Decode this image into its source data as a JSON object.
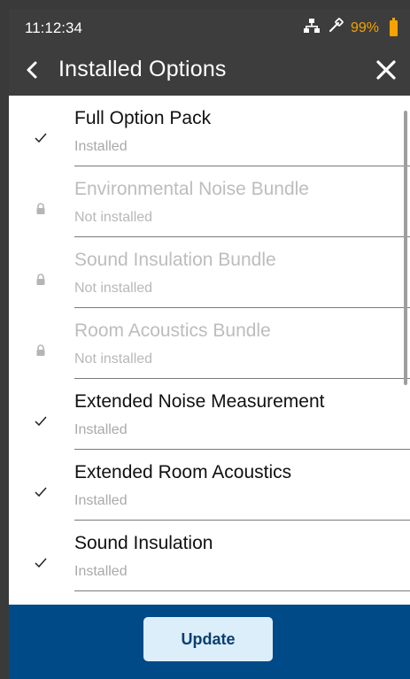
{
  "status": {
    "time": "11:12:34",
    "network_icon": "network-icon",
    "probe_icon": "probe-icon",
    "battery_percent": "99%",
    "accent": "#f5a300"
  },
  "header": {
    "title": "Installed Options",
    "back_icon": "chevron-left-icon",
    "close_icon": "close-icon"
  },
  "items": [
    {
      "name": "Full Option Pack",
      "status": "Installed",
      "installed": true
    },
    {
      "name": "Environmental Noise Bundle",
      "status": "Not installed",
      "installed": false
    },
    {
      "name": "Sound Insulation Bundle",
      "status": "Not installed",
      "installed": false
    },
    {
      "name": "Room Acoustics Bundle",
      "status": "Not installed",
      "installed": false
    },
    {
      "name": "Extended Noise Measurement",
      "status": "Installed",
      "installed": true
    },
    {
      "name": "Extended Room Acoustics",
      "status": "Installed",
      "installed": true
    },
    {
      "name": "Sound Insulation",
      "status": "Installed",
      "installed": true
    }
  ],
  "footer": {
    "update_label": "Update",
    "bg": "#004a87"
  }
}
